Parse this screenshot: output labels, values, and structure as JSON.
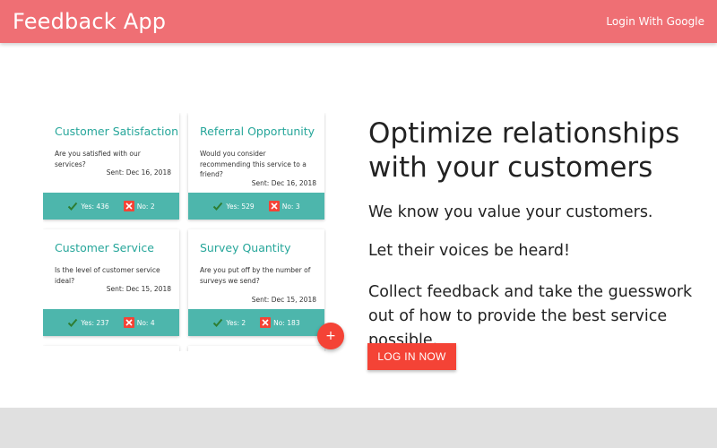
{
  "navbar": {
    "brand": "Feedback App",
    "login_link": "Login With Google",
    "background_color": "#ef6f74"
  },
  "cards": [
    {
      "title": "Customer Satisfaction",
      "question": "Are you satisfied with our services?",
      "sent": "Sent: Dec 16, 2018",
      "yes": "Yes: 436",
      "no": "No: 2"
    },
    {
      "title": "Referral Opportunity",
      "question": "Would you consider recommending this service to a friend?",
      "sent": "Sent: Dec 16, 2018",
      "yes": "Yes: 529",
      "no": "No: 3"
    },
    {
      "title": "Customer Service",
      "question": "Is the level of customer service ideal?",
      "sent": "Sent: Dec 15, 2018",
      "yes": "Yes: 237",
      "no": "No: 4"
    },
    {
      "title": "Survey Quantity",
      "question": "Are you put off by the number of surveys we send?",
      "sent": "Sent: Dec 15, 2018",
      "yes": "Yes: 2",
      "no": "No: 183"
    }
  ],
  "fab": {
    "label": "+",
    "color": "#f44336"
  },
  "hero": {
    "title": "Optimize relationships with your customers",
    "line1": "We know you value your customers.",
    "line2": "Let their voices be heard!",
    "line3": "Collect feedback and take the guesswork out of how to provide the best service possible.",
    "button_label": "LOG IN NOW"
  },
  "colors": {
    "accent_teal": "#26a69a",
    "card_footer": "#4db6ac",
    "button_red": "#f44336",
    "footer_gray": "#e0e0e0"
  },
  "icons": {
    "yes": "check-icon",
    "no": "close-icon"
  }
}
